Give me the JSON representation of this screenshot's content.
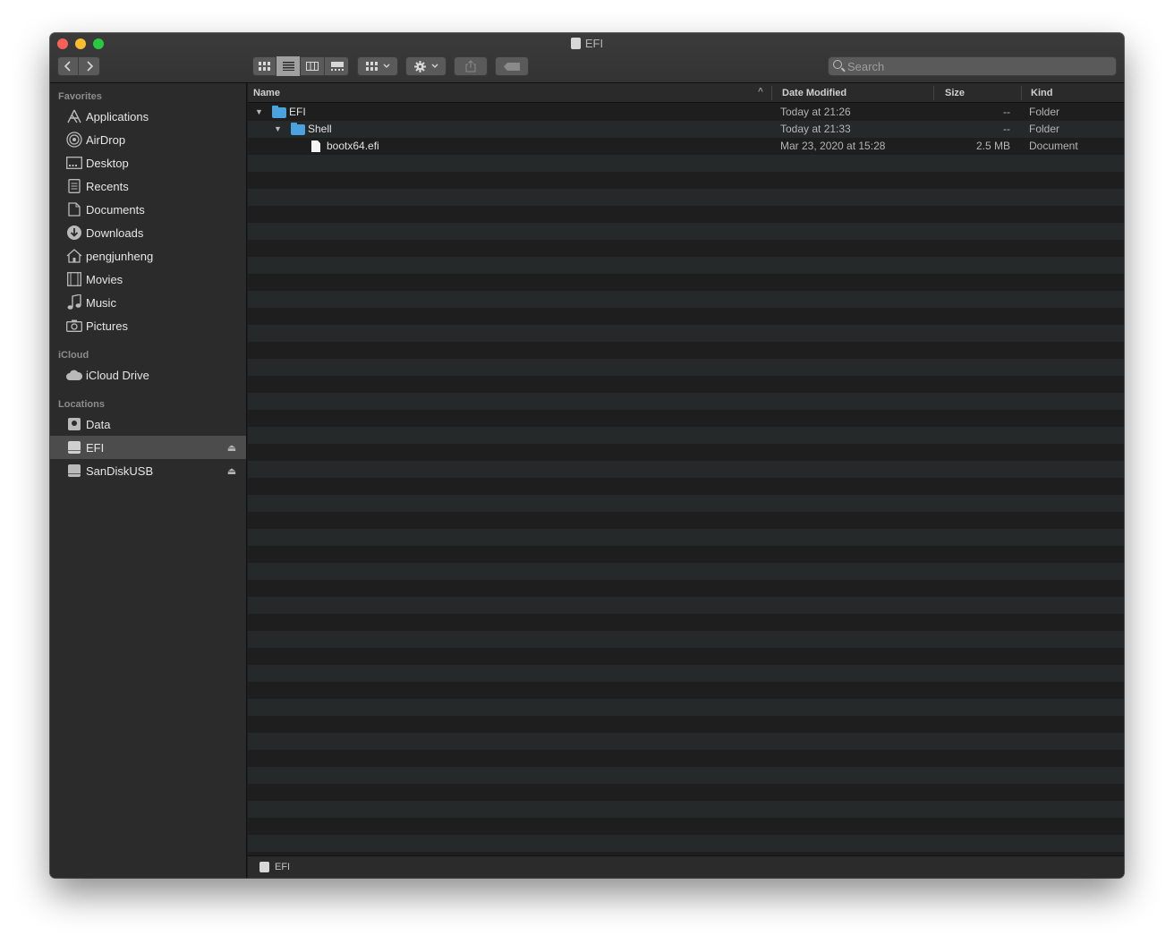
{
  "window": {
    "title": "EFI"
  },
  "toolbar": {
    "back_icon": "chevron-left-icon",
    "forward_icon": "chevron-right-icon",
    "view_modes": [
      "icon-view",
      "list-view",
      "column-view",
      "gallery-view"
    ],
    "selected_view": "list-view",
    "search_placeholder": "Search"
  },
  "sidebar": {
    "sections": [
      {
        "title": "Favorites",
        "items": [
          {
            "label": "Applications",
            "icon": "applications-icon"
          },
          {
            "label": "AirDrop",
            "icon": "airdrop-icon"
          },
          {
            "label": "Desktop",
            "icon": "desktop-icon"
          },
          {
            "label": "Recents",
            "icon": "recents-icon"
          },
          {
            "label": "Documents",
            "icon": "documents-icon"
          },
          {
            "label": "Downloads",
            "icon": "downloads-icon"
          },
          {
            "label": "pengjunheng",
            "icon": "home-icon"
          },
          {
            "label": "Movies",
            "icon": "movies-icon"
          },
          {
            "label": "Music",
            "icon": "music-icon"
          },
          {
            "label": "Pictures",
            "icon": "pictures-icon"
          }
        ]
      },
      {
        "title": "iCloud",
        "items": [
          {
            "label": "iCloud Drive",
            "icon": "cloud-icon"
          }
        ]
      },
      {
        "title": "Locations",
        "items": [
          {
            "label": "Data",
            "icon": "disk-icon"
          },
          {
            "label": "EFI",
            "icon": "disk-icon",
            "selected": true,
            "eject": true
          },
          {
            "label": "SanDiskUSB",
            "icon": "disk-icon",
            "eject": true
          }
        ]
      }
    ]
  },
  "columns": {
    "name": "Name",
    "date": "Date Modified",
    "size": "Size",
    "kind": "Kind"
  },
  "files": [
    {
      "name": "EFI",
      "date": "Today at 21:26",
      "size": "--",
      "kind": "Folder",
      "type": "folder",
      "expanded": true
    },
    {
      "name": "Shell",
      "date": "Today at 21:33",
      "size": "--",
      "kind": "Folder",
      "type": "folder",
      "expanded": true
    },
    {
      "name": "bootx64.efi",
      "date": "Mar 23, 2020 at 15:28",
      "size": "2.5 MB",
      "kind": "Document",
      "type": "document"
    }
  ],
  "pathbar": {
    "label": "EFI"
  }
}
